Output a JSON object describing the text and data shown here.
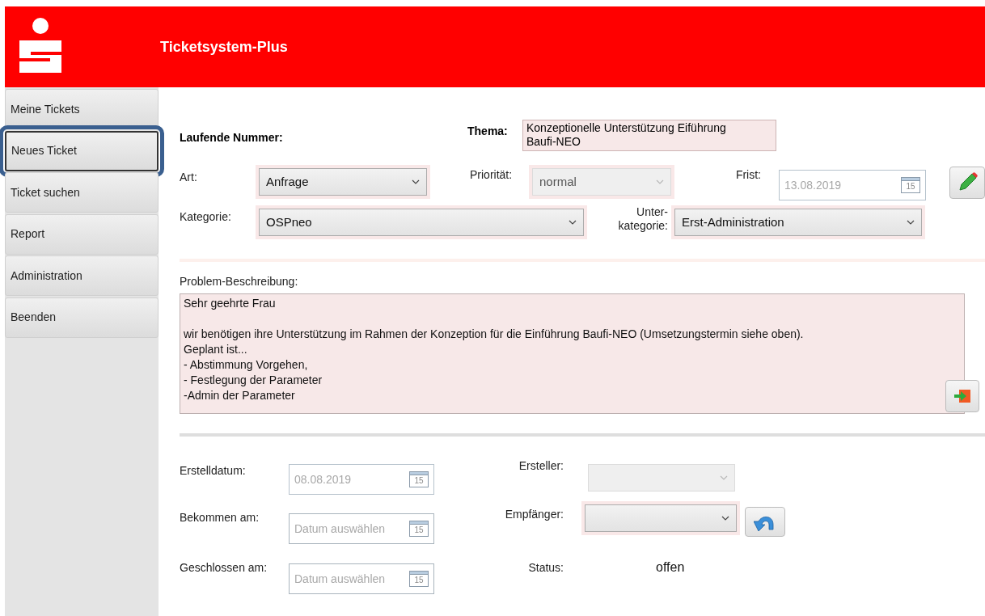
{
  "header": {
    "title": "Ticketsystem-Plus"
  },
  "sidebar": {
    "items": [
      {
        "label": "Meine Tickets",
        "selected": false
      },
      {
        "label": "Neues Ticket",
        "selected": true
      },
      {
        "label": "Ticket suchen",
        "selected": false
      },
      {
        "label": "Report",
        "selected": false
      },
      {
        "label": "Administration",
        "selected": false
      },
      {
        "label": "Beenden",
        "selected": false
      }
    ]
  },
  "ticket": {
    "number_label": "Laufende Nummer:",
    "topic_label": "Thema:",
    "topic_lines": [
      "Konzeptionelle Unterstützung Eiführung",
      "Baufi-NEO"
    ],
    "art": {
      "label": "Art:",
      "value": "Anfrage",
      "required": true,
      "disabled": false
    },
    "priority": {
      "label": "Priorität:",
      "value": "normal",
      "required": true,
      "disabled": true
    },
    "deadline": {
      "label": "Frist:",
      "value": "13.08.2019",
      "calendar_day": "15",
      "disabled": true
    },
    "category": {
      "label": "Kategorie:",
      "value": "OSPneo",
      "required": true,
      "disabled": false
    },
    "subcategory": {
      "label_lines": [
        "Unter-",
        "kategorie:"
      ],
      "value": "Erst-Administration",
      "required": true,
      "disabled": false
    },
    "description_label": "Problem-Beschreibung:",
    "description_paragraphs": [
      [
        "Sehr geehrte Frau"
      ],
      [
        "wir benötigen ihre Unterstützung im Rahmen der Konzeption für die Einführung Baufi-NEO (Umsetzungstermin siehe oben).",
        "Geplant ist...",
        "- Abstimmung Vorgehen,",
        "- Festlegung der Parameter",
        "-Admin der Parameter"
      ]
    ]
  },
  "dates": [
    {
      "label": "Erstelldatum:",
      "value": "08.08.2019",
      "calendar_day": "15",
      "disabled": true
    },
    {
      "label": "Bekommen am:",
      "placeholder": "Datum auswählen",
      "calendar_day": "15",
      "disabled": false
    },
    {
      "label": "Geschlossen am:",
      "placeholder": "Datum auswählen",
      "calendar_day": "15",
      "disabled": false
    }
  ],
  "creator": {
    "label": "Ersteller:",
    "required": false,
    "disabled": true
  },
  "recipient": {
    "label": "Empfänger:",
    "required": true,
    "disabled": false
  },
  "status": {
    "label": "Status:",
    "value": "offen"
  }
}
